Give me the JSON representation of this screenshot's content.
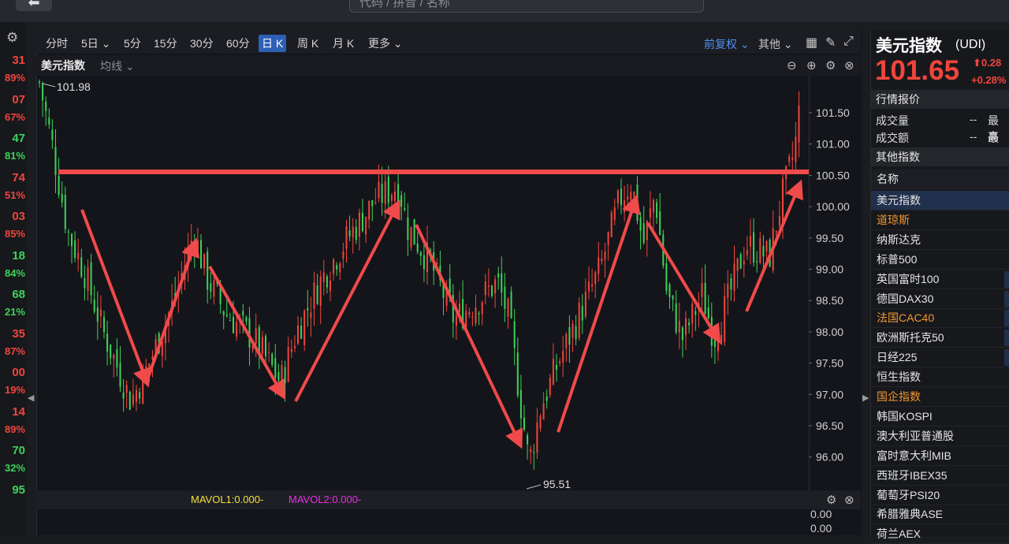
{
  "search": {
    "placeholder": "代码 / 拼音 / 名称"
  },
  "left_strip": [
    {
      "value": "31",
      "pct": "89%",
      "color": "red"
    },
    {
      "value": "07",
      "pct": "67%",
      "color": "red"
    },
    {
      "value": "47",
      "pct": "81%",
      "color": "green"
    },
    {
      "value": "74",
      "pct": "51%",
      "color": "red"
    },
    {
      "value": "03",
      "pct": "85%",
      "color": "red"
    },
    {
      "value": "18",
      "pct": "84%",
      "color": "green"
    },
    {
      "value": "68",
      "pct": "21%",
      "color": "green"
    },
    {
      "value": "35",
      "pct": "87%",
      "color": "red"
    },
    {
      "value": "00",
      "pct": "19%",
      "color": "red"
    },
    {
      "value": "14",
      "pct": "89%",
      "color": "red"
    },
    {
      "value": "70",
      "pct": "32%",
      "color": "green"
    },
    {
      "value": "95",
      "pct": "",
      "color": "green"
    }
  ],
  "tabs": [
    "分时",
    "5日",
    "5分",
    "15分",
    "30分",
    "60分",
    "日 K",
    "周 K",
    "月 K",
    "更多"
  ],
  "active_tab": "日 K",
  "adjust_label": "前复权",
  "other_label": "其他",
  "chart": {
    "title": "美元指数",
    "ma_label": "均线",
    "high_label": "101.98",
    "low_label": "95.51",
    "y_ticks": [
      "101.50",
      "101.00",
      "100.50",
      "100.00",
      "99.50",
      "99.00",
      "98.50",
      "98.00",
      "97.50",
      "97.00",
      "96.50",
      "96.00"
    ],
    "mavol1": "MAVOL1:0.000-",
    "mavol2": "MAVOL2:0.000-",
    "vol_ticks": [
      "0.00",
      "0.00"
    ]
  },
  "colors": {
    "up": "#f1453d",
    "down": "#3cd35a",
    "accent": "#2d5fb5",
    "annotation": "#f04a4a"
  },
  "quote": {
    "name": "美元指数",
    "code": "(UDI)",
    "price": "101.65",
    "change": "0.28",
    "change_pct": "+0.28%",
    "section_quote": "行情报价",
    "volume_label": "成交量",
    "volume_value": "--",
    "amount_label": "成交额",
    "amount_value": "--",
    "high_label": "最高",
    "low_label": "最低",
    "section_other": "其他指数",
    "list_header": "名称",
    "indices": [
      "美元指数",
      "道琼斯",
      "纳斯达克",
      "标普500",
      "英国富时100",
      "德国DAX30",
      "法国CAC40",
      "欧洲斯托克50",
      "日经225",
      "恒生指数",
      "国企指数",
      "韩国KOSPI",
      "澳大利亚普通股",
      "富时意大利MIB",
      "西班牙IBEX35",
      "葡萄牙PSI20",
      "希腊雅典ASE",
      "荷兰AEX"
    ]
  }
}
